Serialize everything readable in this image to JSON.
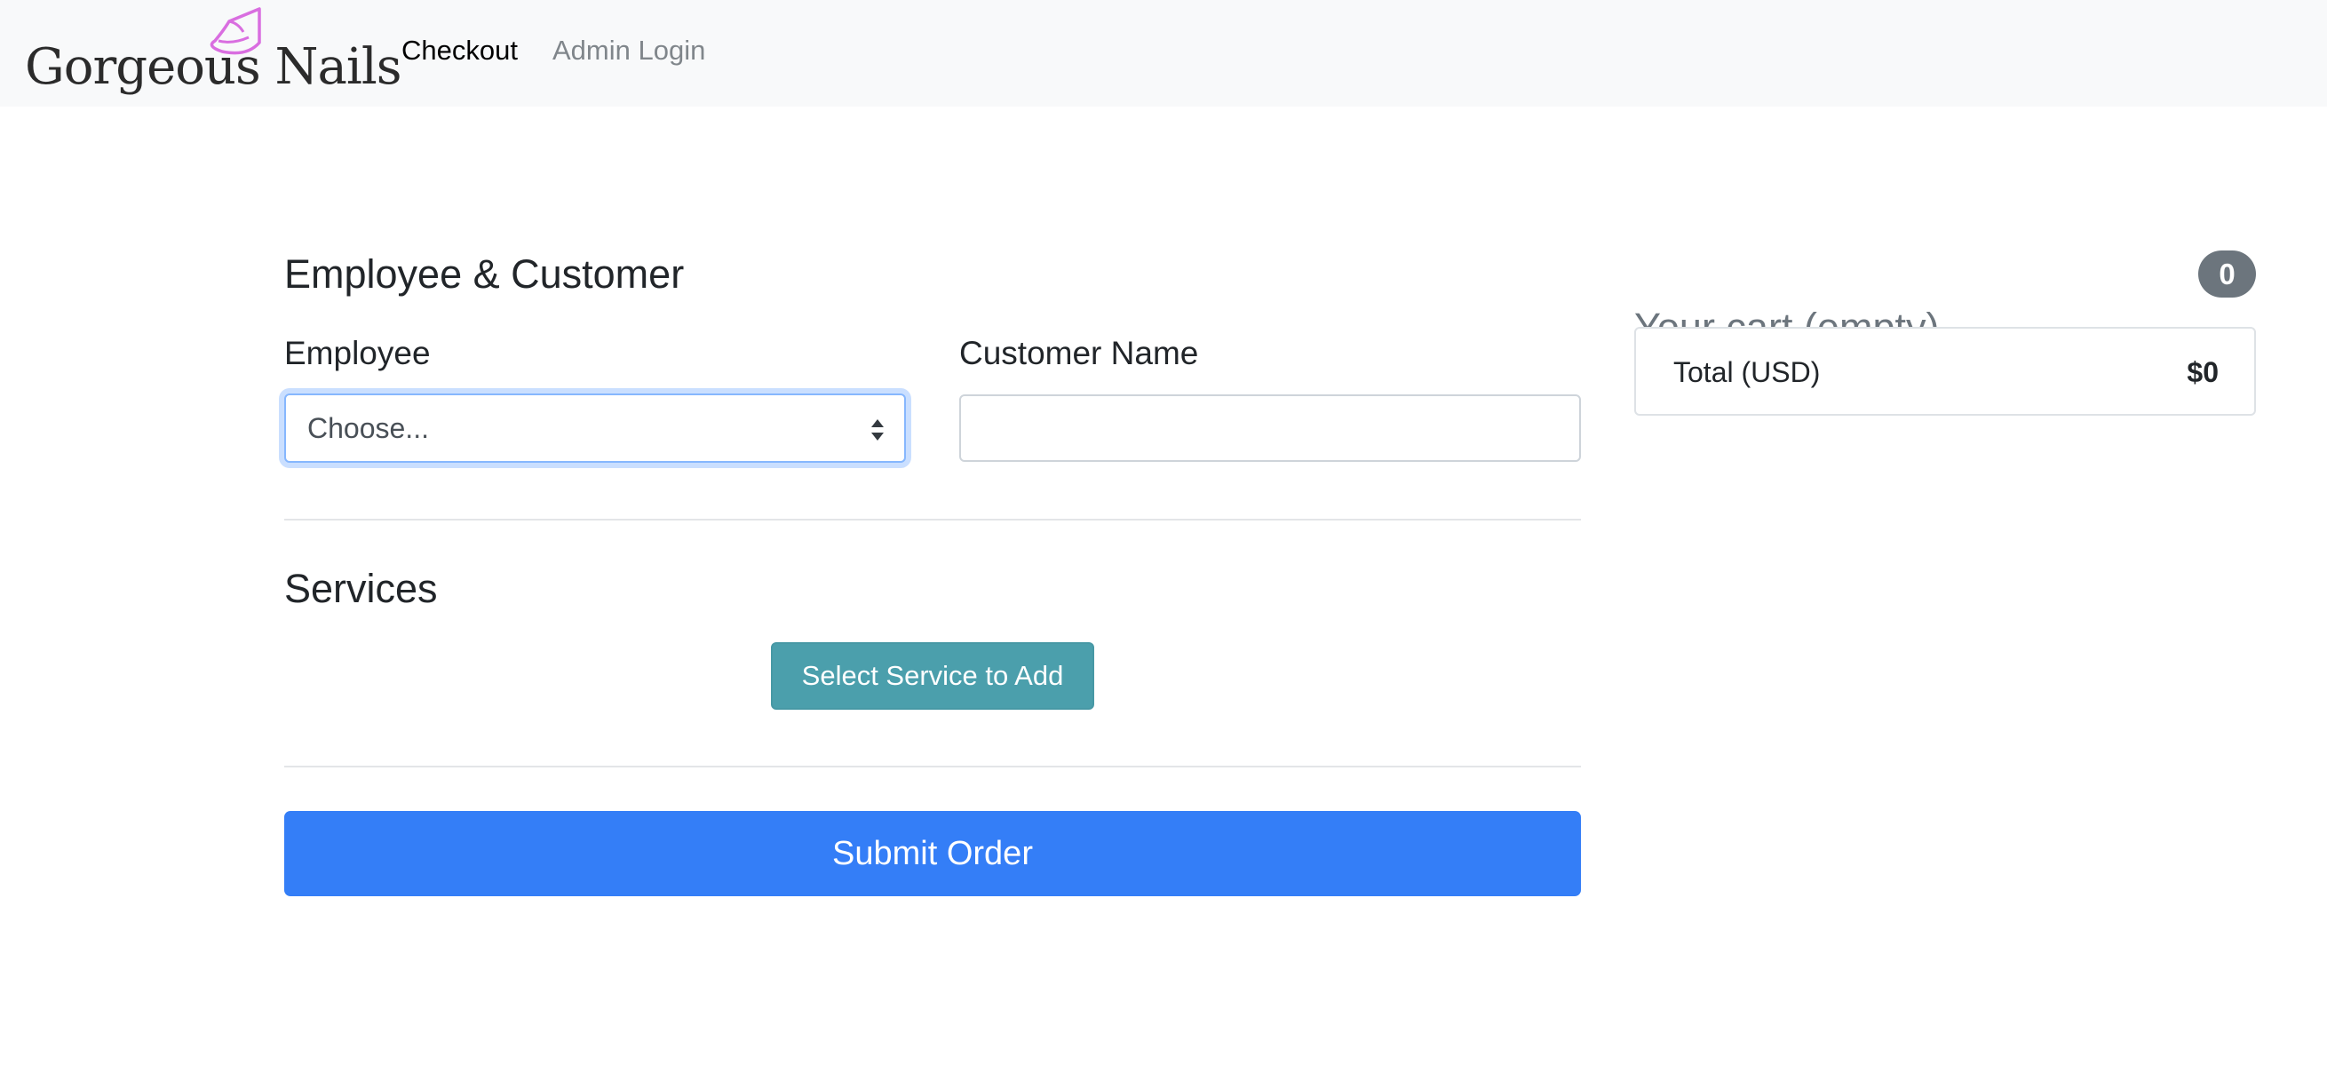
{
  "navbar": {
    "brand": "Gorgeous Nails",
    "links": [
      {
        "label": "Checkout",
        "active": true
      },
      {
        "label": "Admin Login",
        "active": false
      }
    ],
    "brand_mark_icon": "nail-polish-icon",
    "brand_mark_color": "#d96ee0"
  },
  "form": {
    "employee_customer_heading": "Employee & Customer",
    "employee_label": "Employee",
    "employee_select_value": "Choose...",
    "customer_label": "Customer Name",
    "customer_value": "",
    "customer_placeholder": "",
    "services_heading": "Services",
    "select_service_button": "Select Service to Add",
    "submit_button": "Submit Order"
  },
  "cart": {
    "title": "Your cart (empty)",
    "count": "0",
    "total_label": "Total (USD)",
    "total_value": "$0"
  },
  "colors": {
    "primary": "#347ef7",
    "info": "#4b9fac",
    "secondary": "#6c757d",
    "navbar_bg": "#f8f9fa"
  }
}
